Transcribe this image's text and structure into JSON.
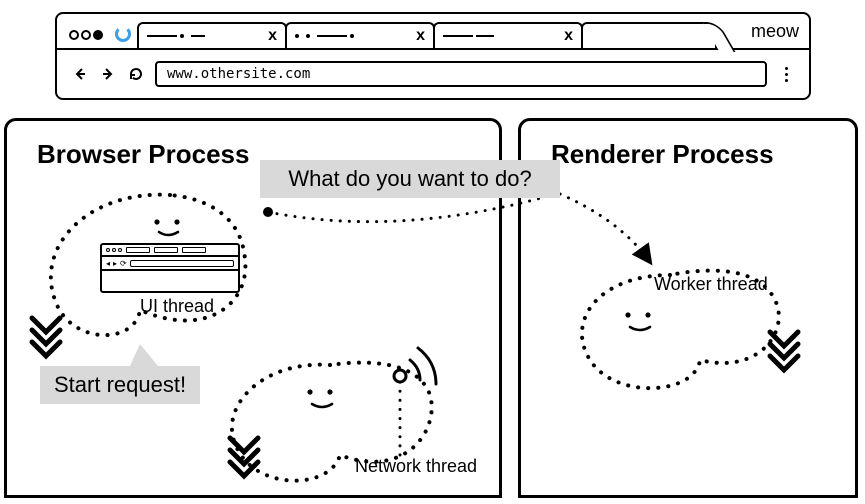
{
  "browser": {
    "window_label": "meow",
    "url": "www.othersite.com",
    "tabs": [
      {
        "close": "x"
      },
      {
        "close": "x"
      },
      {
        "close": "x"
      }
    ]
  },
  "processes": {
    "browser": {
      "title": "Browser Process"
    },
    "renderer": {
      "title": "Renderer Process"
    }
  },
  "threads": {
    "ui": "UI thread",
    "network": "Network thread",
    "worker": "Worker thread"
  },
  "callouts": {
    "question": "What do you want to do?",
    "start": "Start request!"
  }
}
